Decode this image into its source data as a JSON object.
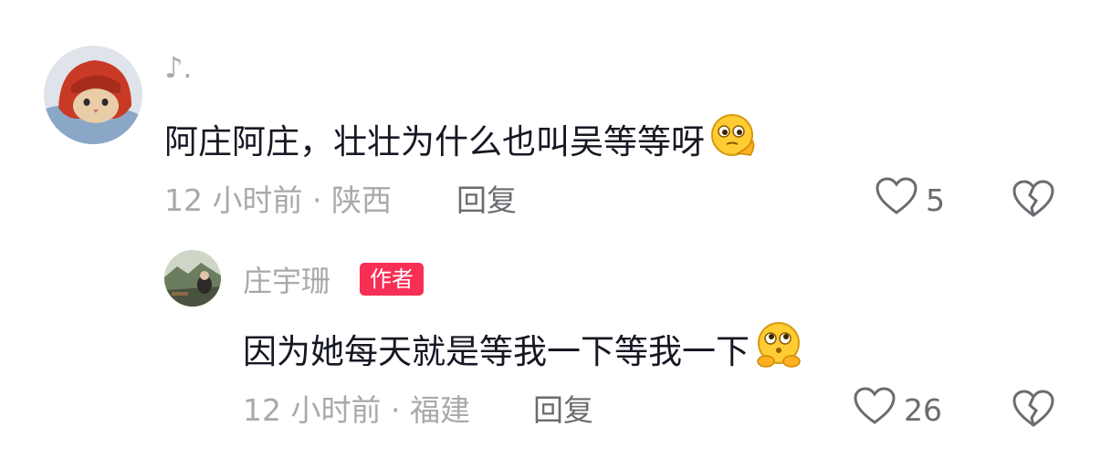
{
  "comment": {
    "username": "♪.",
    "text": "阿庄阿庄，壮壮为什么也叫吴等等呀",
    "emoji": "thinking-face-emoji",
    "time": "12 小时前",
    "location": "陕西",
    "reply_label": "回复",
    "like_count": "5"
  },
  "reply": {
    "username": "庄宇珊",
    "badge": "作者",
    "text": "因为她每天就是等我一下等我一下",
    "emoji": "shushing-face-emoji",
    "time": "12 小时前",
    "location": "福建",
    "reply_label": "回复",
    "like_count": "26"
  },
  "icons": {
    "like": "heart-outline-icon",
    "dislike": "broken-heart-icon"
  },
  "colors": {
    "badge": "#f72f54",
    "text": "#161823",
    "muted": "#a9a9ad"
  }
}
